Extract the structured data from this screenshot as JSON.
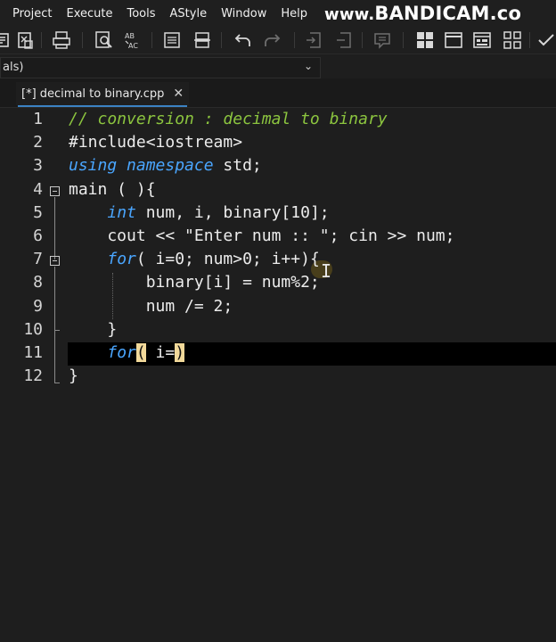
{
  "menu": {
    "items": [
      "Project",
      "Execute",
      "Tools",
      "AStyle",
      "Window",
      "Help"
    ]
  },
  "watermark": {
    "prefix": "www.",
    "brand": "BANDICAM",
    "suffix": ".co"
  },
  "toolbar": {
    "icons": [
      "compile-icon",
      "compile-run-icon",
      "print-icon",
      "find-icon",
      "replace-icon",
      "indent-icon",
      "toggle-bookmark-icon",
      "undo-icon",
      "redo-icon",
      "insert-icon",
      "remove-icon",
      "comment-icon",
      "layout-grid-icon",
      "window-icon",
      "form-icon",
      "tiles-icon",
      "check-icon"
    ]
  },
  "combo": {
    "value": "als)"
  },
  "tab": {
    "label": "[*] decimal to binary.cpp",
    "close": "✕"
  },
  "editor": {
    "line_numbers": [
      "1",
      "2",
      "3",
      "4",
      "5",
      "6",
      "7",
      "8",
      "9",
      "10",
      "11",
      "12"
    ],
    "lines": [
      [
        {
          "t": "// conversion : decimal to binary",
          "c": "comment"
        }
      ],
      [
        {
          "t": "#include<iostream>",
          "c": "plain"
        }
      ],
      [
        {
          "t": "using",
          "c": "kw"
        },
        {
          "t": " ",
          "c": "plain"
        },
        {
          "t": "namespace",
          "c": "kw"
        },
        {
          "t": " std;",
          "c": "plain"
        }
      ],
      [
        {
          "t": "main ( ){",
          "c": "plain"
        }
      ],
      [
        {
          "t": "    ",
          "c": "plain"
        },
        {
          "t": "int",
          "c": "kw"
        },
        {
          "t": " num, i, binary[10];",
          "c": "plain"
        }
      ],
      [
        {
          "t": "    cout << \"Enter num :: \"; cin >> num;",
          "c": "plain"
        }
      ],
      [
        {
          "t": "    ",
          "c": "plain"
        },
        {
          "t": "for",
          "c": "kw"
        },
        {
          "t": "( i=0; num>0; i++){",
          "c": "plain"
        }
      ],
      [
        {
          "t": "        binary[i] = num%2;",
          "c": "plain"
        }
      ],
      [
        {
          "t": "        num /= 2;",
          "c": "plain"
        }
      ],
      [
        {
          "t": "    }",
          "c": "plain"
        }
      ],
      [
        {
          "t": "    ",
          "c": "plain"
        },
        {
          "t": "for",
          "c": "kw"
        },
        {
          "t": "(",
          "c": "paren-hl"
        },
        {
          "t": " i=",
          "c": "plain"
        },
        {
          "t": ")",
          "c": "paren-hl"
        }
      ],
      [
        {
          "t": "}",
          "c": "plain"
        }
      ]
    ],
    "current_line": "11"
  },
  "colors": {
    "background": "#1e1e1e",
    "comment": "#8cc53f",
    "keyword": "#4aa6ff",
    "current_line": "#000000",
    "paren_match": "#f2d99a",
    "tab_accent": "#3b82c4"
  }
}
